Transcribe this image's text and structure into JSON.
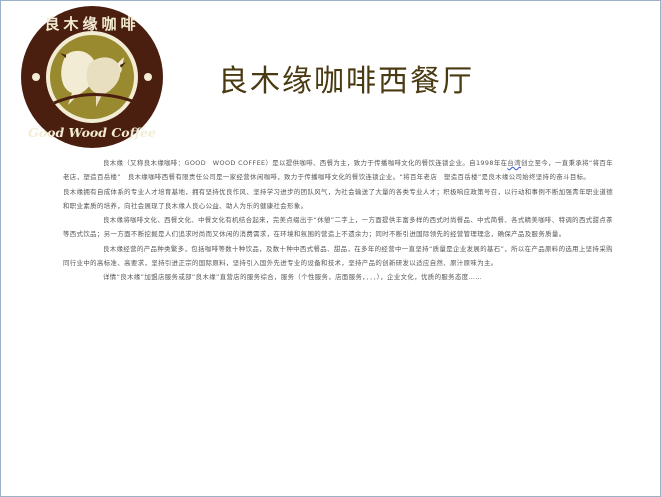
{
  "page": {
    "title": "良木缘咖啡西餐厅"
  },
  "logo": {
    "ring_top_text": "良木缘咖啡",
    "ring_bottom_text": "Good Wood Coffee",
    "colors": {
      "ring": "#4a1f10",
      "inner": "#9a8a2f",
      "birds": "#f3ecd5"
    }
  },
  "content": {
    "p1_a": "良木缘（又称良木缘咖啡：GOOD　WOOD COFFEE）是以提供咖啡、西餐为主，致力于传播咖啡文化的餐饮连锁企业。自1998年在",
    "p1_b": "台湾",
    "p1_c": "创立至今，一直秉承将“将百年老店，塑造百岳楼”　良木缘咖啡西餐有限责任公司是一家经营休闲咖啡，致力于传播咖啡文化的餐饮连锁企业。“将百年老店　塑造百岳楼”是良木缘公司始终坚持的奋斗目标。",
    "p2": "良木缘拥有自成体系的专业人才培育基地，拥有坚持优良作风、坚持学习进步的团队风气，为社会输送了大量的各类专业人才；积极响应政策号召，以行动和事例不断加强青年职业道德和职业素质的培养，向社会展现了良木缘人良心公益、助人为乐的健康社会形象。",
    "p3": "良木缘将咖啡文化、西餐文化、中餐文化有机结合起来，完美点缀出于“休憩”二字上，一方面提供丰富多样的西式时尚餐品、中式简餐、各式精美咖啡、特调的西式甜点茶等西式饮品；另一方面不断挖掘是人们追求时尚而又休闲的消费需求，在环境和氛围的营造上不遗余力；同时不断引进国际领先的经营管理理念，确保产品及服务质量。",
    "p4": "良木缘经营的产品种类繁多，包括咖啡等数十种饮品，及数十种中西式餐品、甜品，在多年的经营中一直坚持“质量是企业发展的基石”，所以在产品原料的选用上坚持采购同行业中的高标准、高要求，坚持引进正宗的国际原料，坚持引入国外先进专业的设备和技术，坚持产品的创新研发以适应自然、原汁原味为主。",
    "p5": "详情“良木缘”加盟店服务或部“良木缘”直营店的服务综合，服务（个性服务，店面服务，．．．），企业文化，优质的服务态度……"
  }
}
